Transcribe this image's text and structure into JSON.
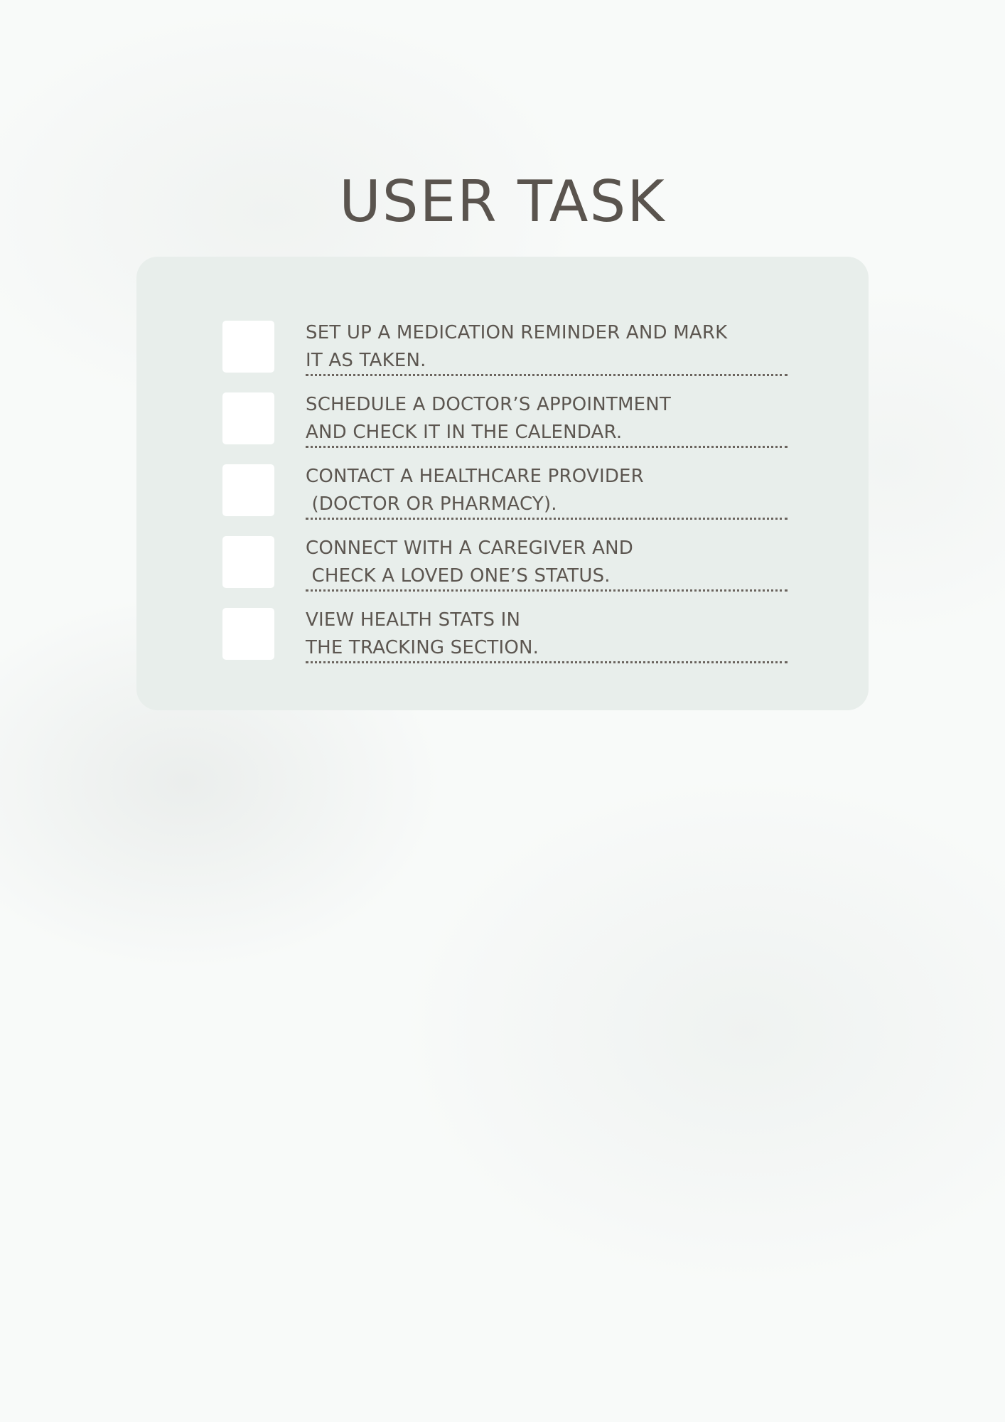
{
  "page": {
    "title": "USER TASK"
  },
  "tasks": [
    {
      "line1": "SET UP A MEDICATION REMINDER AND MARK",
      "line2": "IT AS TAKEN.",
      "checked": false
    },
    {
      "line1": "SCHEDULE A DOCTOR’S APPOINTMENT",
      "line2": "AND CHECK IT IN THE CALENDAR.",
      "checked": false
    },
    {
      "line1": "CONTACT A HEALTHCARE PROVIDER",
      "line2": " (DOCTOR OR PHARMACY).",
      "checked": false
    },
    {
      "line1": "CONNECT WITH A CAREGIVER AND",
      "line2": " CHECK A LOVED ONE’S STATUS.",
      "checked": false
    },
    {
      "line1": "VIEW HEALTH STATS IN",
      "line2": "THE TRACKING SECTION.",
      "checked": false
    }
  ],
  "colors": {
    "background": "#f8faf9",
    "card": "#e8eeeb",
    "text": "#5c5650",
    "checkbox": "#ffffff"
  }
}
